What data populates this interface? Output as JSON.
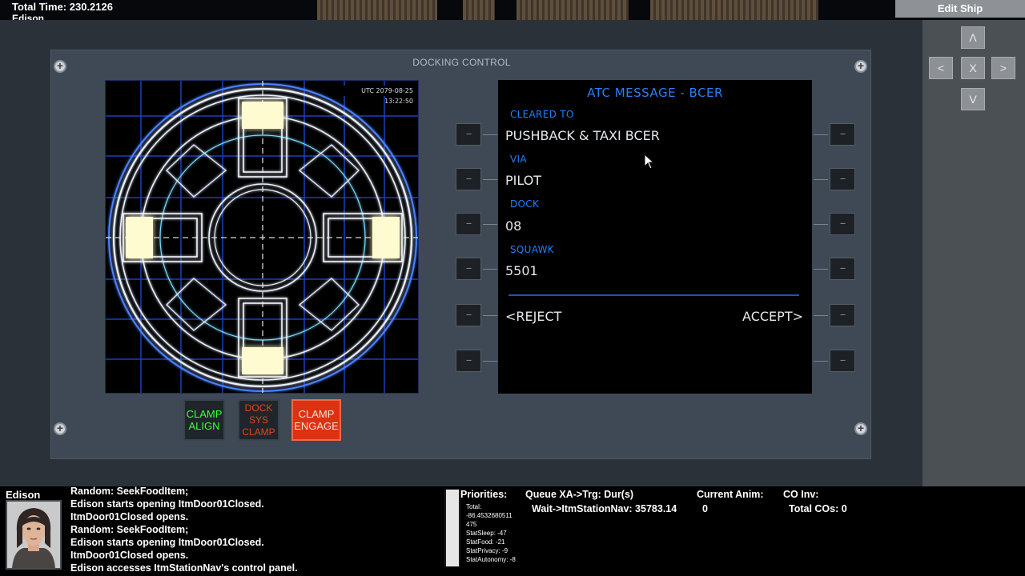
{
  "hud": {
    "total_time": "Total Time: 230.2126",
    "character_name_top": "Edison",
    "edit_ship_label": "Edit Ship"
  },
  "nav": {
    "up": "Λ",
    "left": "<",
    "close": "X",
    "right": ">",
    "down": "V"
  },
  "panel": {
    "title": "DOCKING CONTROL",
    "screw_glyph": "+",
    "utc": "UTC 2079-08-25 13:22:50"
  },
  "clamp_buttons": {
    "align": [
      "CLAMP",
      "ALIGN"
    ],
    "dock_sys": [
      "DOCK",
      "SYS",
      "CLAMP"
    ],
    "engage": [
      "CLAMP",
      "ENGAGE"
    ]
  },
  "mcdu": {
    "title": "ATC MESSAGE - BCER",
    "rows": [
      {
        "label": "CLEARED TO",
        "value": "PUSHBACK & TAXI BCER"
      },
      {
        "label": "VIA",
        "value": "PILOT"
      },
      {
        "label": "DOCK",
        "value": "08"
      },
      {
        "label": "SQUAWK",
        "value": "5501"
      }
    ],
    "reject": "<REJECT",
    "accept": "ACCEPT>",
    "lsk_label": "---"
  },
  "status": {
    "character_name": "Edison",
    "log": [
      "Random: SeekFoodItem;",
      "Edison starts opening ItmDoor01Closed.",
      "ItmDoor01Closed opens.",
      "Random: SeekFoodItem;",
      "Edison starts opening ItmDoor01Closed.",
      "ItmDoor01Closed opens.",
      "Edison accesses ItmStationNav's control panel."
    ],
    "priorities_header": "Priorities:",
    "priorities": [
      "Total:",
      "-86.4532680511",
      "475",
      "StatSleep: -47",
      "StatFood: -21",
      "StatPrivacy: -9",
      "StatAutonomy: -8"
    ],
    "queue_header": "Queue XA->Trg: Dur(s)",
    "queue_value": "Wait->ItmStationNav: 35783.14",
    "anim_header": "Current Anim:",
    "anim_value": "0",
    "co_header": "CO Inv:",
    "co_value": "Total COs: 0"
  },
  "colors": {
    "mcdu_label": "#1f7fff",
    "mcdu_value": "#e5e8ec",
    "radar_grid": "#1b49d6",
    "clamp_glow": "#fffbd0",
    "engage_red": "#dd3212",
    "align_green": "#3dff3d"
  }
}
